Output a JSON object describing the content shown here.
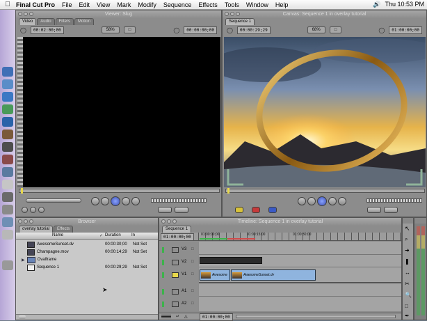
{
  "menubar": {
    "app": "Final Cut Pro",
    "items": [
      "File",
      "Edit",
      "View",
      "Mark",
      "Modify",
      "Sequence",
      "Effects",
      "Tools",
      "Window",
      "Help"
    ],
    "clock": "Thu 10:53 PM"
  },
  "viewer": {
    "title": "Viewer: Slug",
    "tabs": [
      "Video",
      "Audio",
      "Filters",
      "Motion"
    ],
    "zoom": "58%",
    "timecode_left": "00:02:00;00",
    "timecode_right": "00:00:00;00"
  },
  "canvas": {
    "title": "Canvas: Sequence 1 in overlay tutorial",
    "tab": "Sequence 1",
    "timecode_left": "00:00:29;29",
    "zoom": "68%",
    "timecode_right": "01:00:00;00"
  },
  "browser": {
    "title": "Browser",
    "tabs": [
      "overlay tutorial",
      "Effects"
    ],
    "columns": [
      "Name",
      "Duration",
      "In"
    ],
    "items": [
      {
        "name": "AwesomeSunset.dv",
        "duration": "00:00:30;00",
        "in": "Not Set"
      },
      {
        "name": "Champagne.mov",
        "duration": "00:00:14;29",
        "in": "Not Set"
      },
      {
        "name": "Ovalframe",
        "duration": "",
        "in": ""
      },
      {
        "name": "Sequence 1",
        "duration": "00:00:29;29",
        "in": "Not Set"
      }
    ]
  },
  "timeline": {
    "title": "Timeline: Sequence 1 in overlay tutorial",
    "tab": "Sequence 1",
    "timecode": "01:00:00;00",
    "ruler": [
      "01:00:00;00",
      "01:00:15;00",
      "01:00:30;00"
    ],
    "tracks": [
      "V3",
      "V2",
      "V1",
      "A1",
      "A2"
    ],
    "clips": [
      {
        "track": "V1",
        "label": "Awesome"
      },
      {
        "track": "V1",
        "label": "AwesomeSunset.dv"
      }
    ],
    "footer_timecode": "01:00:00;00"
  },
  "colors": {
    "menubar_bg": "#ececec",
    "window_bg": "#8c8c8c",
    "clip_blue": "#8fb4de",
    "dock": "#c3b5dd"
  }
}
